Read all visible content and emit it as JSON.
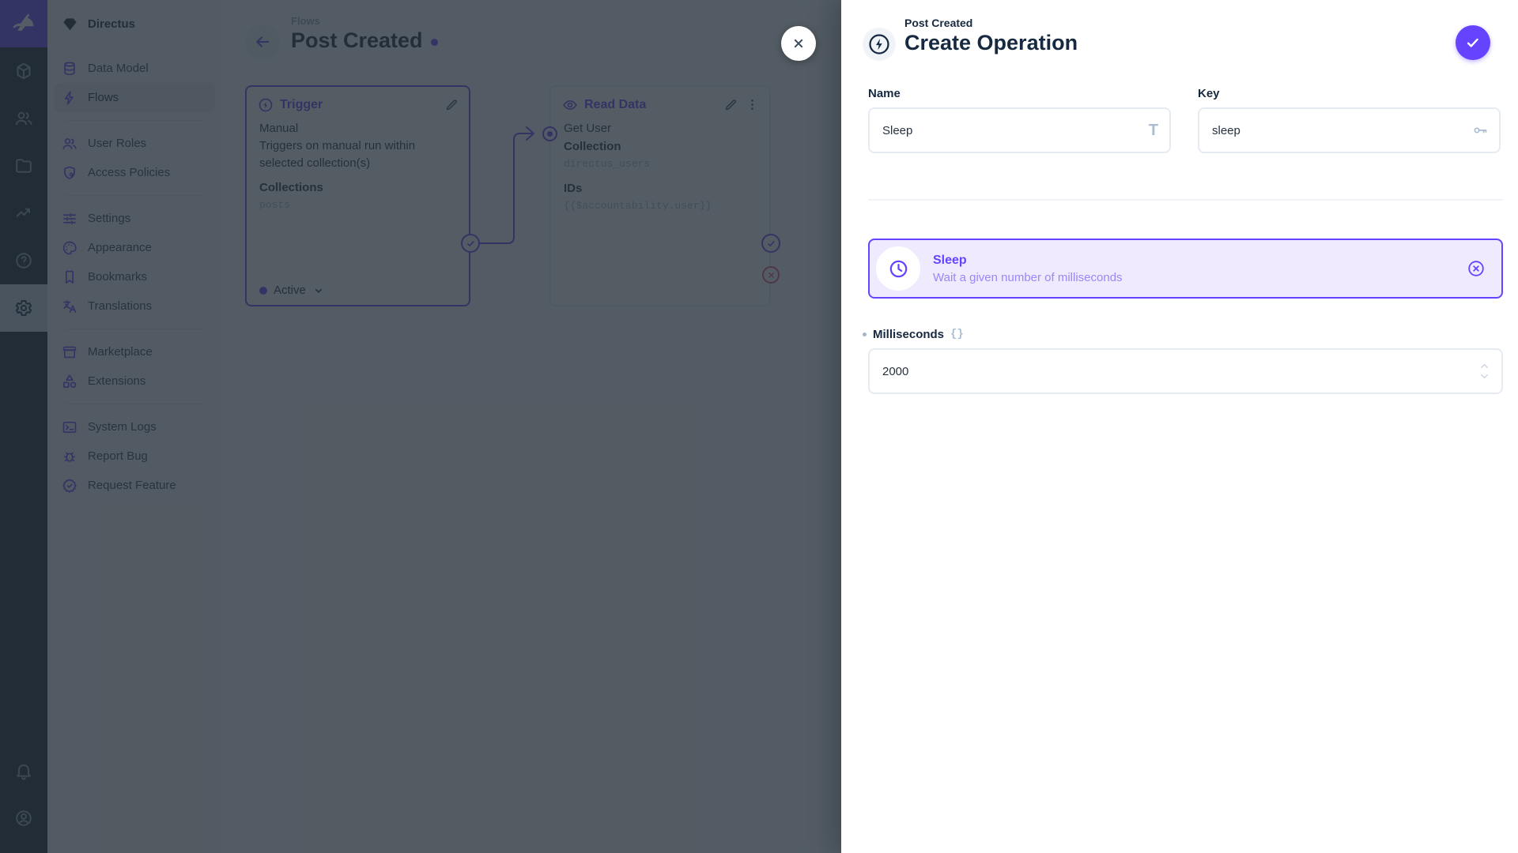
{
  "project": {
    "name": "Directus"
  },
  "colors": {
    "accent": "#6644FF",
    "danger": "#E35169",
    "module_bar": "#18222F",
    "nav_bg": "#F0F4F9",
    "card_bg": "#EFEAFE"
  },
  "module_bar": {
    "modules": [
      "directus-logo",
      "content",
      "users",
      "files",
      "insights",
      "help",
      "settings"
    ],
    "active_module": "settings",
    "bottom": [
      "notifications",
      "account"
    ]
  },
  "nav": {
    "sections": [
      {
        "items": [
          {
            "icon": "database",
            "label": "Data Model"
          },
          {
            "icon": "bolt",
            "label": "Flows",
            "active": true
          }
        ]
      },
      {
        "items": [
          {
            "icon": "people",
            "label": "User Roles"
          },
          {
            "icon": "shield-key",
            "label": "Access Policies"
          }
        ]
      },
      {
        "items": [
          {
            "icon": "tune",
            "label": "Settings"
          },
          {
            "icon": "palette",
            "label": "Appearance"
          },
          {
            "icon": "bookmark",
            "label": "Bookmarks"
          },
          {
            "icon": "translate",
            "label": "Translations"
          }
        ]
      },
      {
        "items": [
          {
            "icon": "storefront",
            "label": "Marketplace"
          },
          {
            "icon": "category",
            "label": "Extensions"
          }
        ]
      },
      {
        "items": [
          {
            "icon": "terminal",
            "label": "System Logs"
          },
          {
            "icon": "bug",
            "label": "Report Bug"
          },
          {
            "icon": "verified",
            "label": "Request Feature"
          }
        ]
      }
    ]
  },
  "canvas": {
    "breadcrumb": "Flows",
    "title": "Post Created",
    "trigger": {
      "title": "Trigger",
      "line1": "Manual",
      "desc": "Triggers on manual run within selected collection(s)",
      "field_label": "Collections",
      "field_value": "posts",
      "status": "Active"
    },
    "read": {
      "title": "Read Data",
      "name": "Get User",
      "collection_label": "Collection",
      "collection_value": "directus_users",
      "ids_label": "IDs",
      "ids_value": "{{$accountability.user}}"
    }
  },
  "drawer": {
    "breadcrumb": "Post Created",
    "title": "Create Operation",
    "name": {
      "label": "Name",
      "value": "Sleep"
    },
    "key": {
      "label": "Key",
      "value": "sleep"
    },
    "card": {
      "title": "Sleep",
      "description": "Wait a given number of milliseconds"
    },
    "ms": {
      "label": "Milliseconds",
      "value": "2000"
    }
  },
  "icons": {
    "title_glyph": "T",
    "braces_glyph": "{}"
  }
}
